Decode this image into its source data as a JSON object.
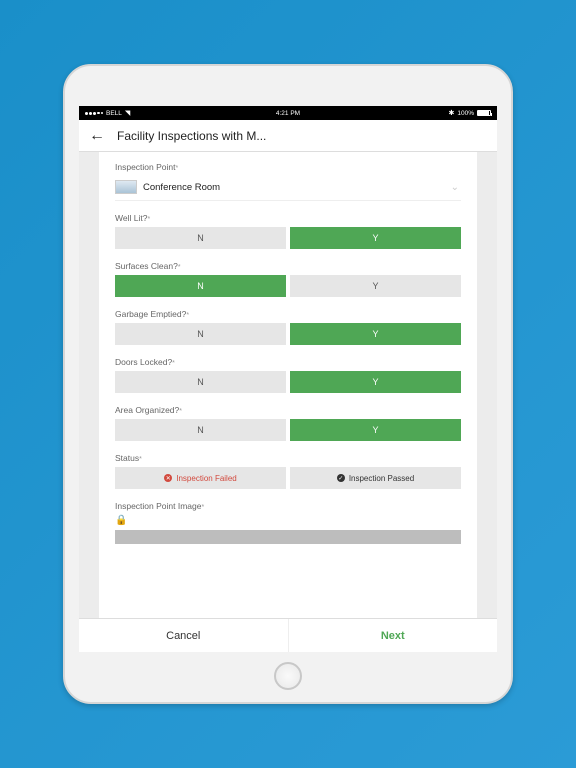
{
  "status_bar": {
    "carrier": "BELL",
    "time": "4:21 PM",
    "battery_pct": "100%"
  },
  "header": {
    "title": "Facility Inspections with M..."
  },
  "form": {
    "inspection_point": {
      "label": "Inspection Point",
      "value": "Conference Room"
    },
    "well_lit": {
      "label": "Well Lit?",
      "n": "N",
      "y": "Y",
      "selected": "Y"
    },
    "surfaces_clean": {
      "label": "Surfaces Clean?",
      "n": "N",
      "y": "Y",
      "selected": "N"
    },
    "garbage": {
      "label": "Garbage Emptied?",
      "n": "N",
      "y": "Y",
      "selected": "Y"
    },
    "doors": {
      "label": "Doors Locked?",
      "n": "N",
      "y": "Y",
      "selected": "Y"
    },
    "organized": {
      "label": "Area Organized?",
      "n": "N",
      "y": "Y",
      "selected": "Y"
    },
    "status": {
      "label": "Status",
      "fail": "Inspection Failed",
      "pass": "Inspection Passed",
      "selected": "fail"
    },
    "image": {
      "label": "Inspection Point Image"
    }
  },
  "footer": {
    "cancel": "Cancel",
    "next": "Next"
  }
}
